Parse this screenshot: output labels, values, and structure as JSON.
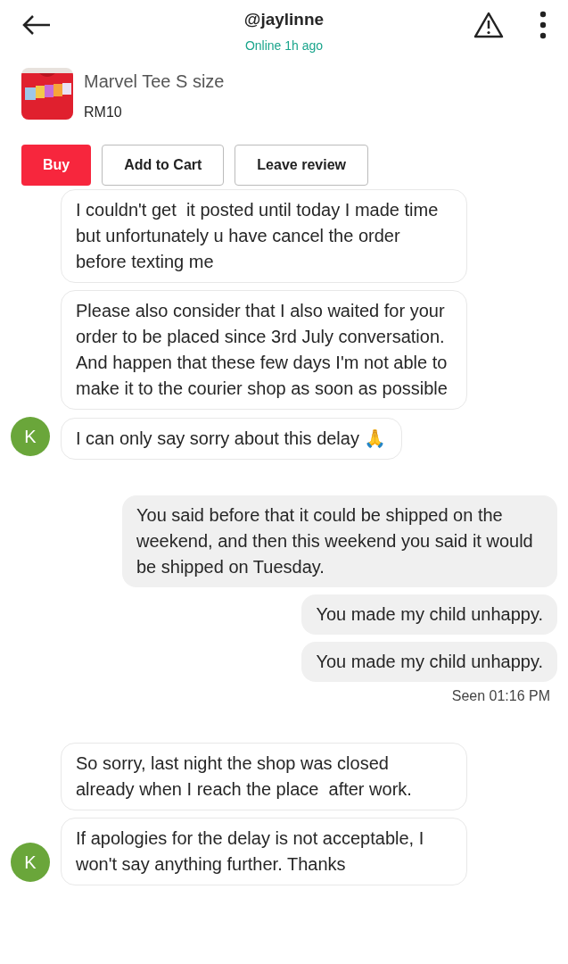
{
  "header": {
    "username": "@jaylinne",
    "status": "Online 1h ago"
  },
  "product": {
    "title": "Marvel Tee S size",
    "price": "RM10"
  },
  "actions": [
    {
      "label": "Buy",
      "kind": "primary"
    },
    {
      "label": "Add to Cart",
      "kind": "outline"
    },
    {
      "label": "Leave review",
      "kind": "outline"
    }
  ],
  "messages": [
    {
      "kind": "incoming",
      "text": "I couldn't get  it posted until today I made time but unfortunately u have cancel the order before texting me"
    },
    {
      "kind": "incoming",
      "text": "Please also consider that I also waited for your order to be placed since 3rd July conversation. And happen that these few days I'm not able to make it to the courier shop as soon as possible"
    },
    {
      "kind": "incoming",
      "text": "I can only say sorry about this delay 🙏",
      "avatar": "K"
    },
    {
      "kind": "outgoing",
      "text": "You said before that it could be shipped on the weekend, and then this weekend you said it would be shipped on Tuesday."
    },
    {
      "kind": "outgoing",
      "text": "You made my child unhappy."
    },
    {
      "kind": "outgoing",
      "text": "You made my child unhappy.",
      "receipt": "Seen 01:16 PM"
    },
    {
      "kind": "incoming",
      "text": "So sorry, last night the shop was closed already when I reach the place  after work."
    },
    {
      "kind": "incoming",
      "text": "If apologies for the delay is not acceptable, I won't say anything further. Thanks",
      "avatar": "K"
    }
  ]
}
